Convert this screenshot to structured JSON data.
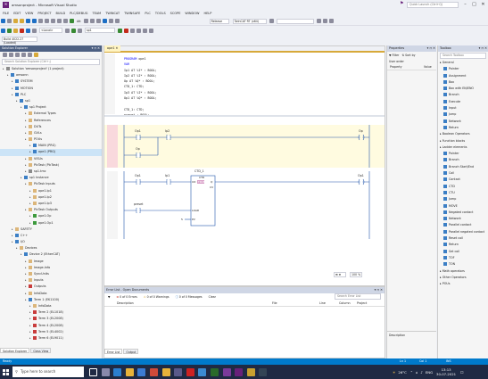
{
  "window": {
    "title": "amsonproject - Microsoft Visual Studio",
    "quick_launch_placeholder": "Quick Launch (Ctrl+Q)"
  },
  "menu": [
    "FILE",
    "EDIT",
    "VIEW",
    "PROJECT",
    "BUILD",
    "PLC/DEBUG",
    "TEAM",
    "TWINCAT",
    "TWINSAFE",
    "PLC",
    "TOOLS",
    "SCOPE",
    "WINDOW",
    "HELP"
  ],
  "toolbar": {
    "config": "Release",
    "platform": "TwinCAT RT (x64)",
    "target": "<Local>",
    "plc_project": "sp1",
    "build_label": "Build 4022.27 (Loaded)",
    "attach": "Att"
  },
  "solution_explorer": {
    "title": "Solution Explorer",
    "search_placeholder": "Search Solution Explorer (Ctrl+;)",
    "items": [
      {
        "label": "Solution 'amsonproject' (1 project)",
        "indent": 0,
        "icon": "gray"
      },
      {
        "label": "amsonn",
        "indent": 1,
        "icon": "blue"
      },
      {
        "label": "SYSTEM",
        "indent": 2,
        "icon": "blue"
      },
      {
        "label": "MOTION",
        "indent": 2,
        "icon": "blue"
      },
      {
        "label": "PLC",
        "indent": 2,
        "icon": "blue"
      },
      {
        "label": "sp1",
        "indent": 3,
        "icon": "blue"
      },
      {
        "label": "sp1 Project",
        "indent": 4,
        "icon": "blue"
      },
      {
        "label": "External Types",
        "indent": 5,
        "icon": "yellow"
      },
      {
        "label": "References",
        "indent": 5,
        "icon": "yellow"
      },
      {
        "label": "DUTs",
        "indent": 5,
        "icon": "yellow"
      },
      {
        "label": "GVLs",
        "indent": 5,
        "icon": "yellow"
      },
      {
        "label": "POUs",
        "indent": 5,
        "icon": "yellow"
      },
      {
        "label": "MAIN (PRG)",
        "indent": 6,
        "icon": "blue"
      },
      {
        "label": "ope1 (PRG)",
        "indent": 6,
        "icon": "blue",
        "selected": true
      },
      {
        "label": "VISUs",
        "indent": 5,
        "icon": "yellow"
      },
      {
        "label": "PlcTask (PlcTask)",
        "indent": 5,
        "icon": "yellow"
      },
      {
        "label": "sp1.tmc",
        "indent": 5,
        "icon": "gray"
      },
      {
        "label": "sp1 Instance",
        "indent": 4,
        "icon": "blue"
      },
      {
        "label": "PlcTask Inputs",
        "indent": 5,
        "icon": "yellow"
      },
      {
        "label": "ope1.Ip1",
        "indent": 6,
        "icon": "yellow"
      },
      {
        "label": "ope1.Ip2",
        "indent": 6,
        "icon": "yellow"
      },
      {
        "label": "ope1.Ip3",
        "indent": 6,
        "icon": "yellow"
      },
      {
        "label": "PlcTask Outputs",
        "indent": 5,
        "icon": "yellow"
      },
      {
        "label": "ope1.Op",
        "indent": 6,
        "icon": "green"
      },
      {
        "label": "ope1.Op1",
        "indent": 6,
        "icon": "green"
      },
      {
        "label": "SAFETY",
        "indent": 2,
        "icon": "yellow"
      },
      {
        "label": "C++",
        "indent": 2,
        "icon": "blue"
      },
      {
        "label": "I/O",
        "indent": 2,
        "icon": "blue"
      },
      {
        "label": "Devices",
        "indent": 3,
        "icon": "yellow"
      },
      {
        "label": "Device 2 (EtherCAT)",
        "indent": 4,
        "icon": "blue"
      },
      {
        "label": "Image",
        "indent": 5,
        "icon": "yellow"
      },
      {
        "label": "Image-Info",
        "indent": 5,
        "icon": "yellow"
      },
      {
        "label": "SyncUnits",
        "indent": 5,
        "icon": "yellow"
      },
      {
        "label": "Inputs",
        "indent": 5,
        "icon": "yellow"
      },
      {
        "label": "Outputs",
        "indent": 5,
        "icon": "red"
      },
      {
        "label": "InfoData",
        "indent": 5,
        "icon": "yellow"
      },
      {
        "label": "Term 1 (EK1100)",
        "indent": 5,
        "icon": "blue"
      },
      {
        "label": "InfoData",
        "indent": 6,
        "icon": "yellow"
      },
      {
        "label": "Term 2 (EL1018)",
        "indent": 6,
        "icon": "red"
      },
      {
        "label": "Term 3 (EL2008)",
        "indent": 6,
        "icon": "red"
      },
      {
        "label": "Term 4 (EL2008)",
        "indent": 6,
        "icon": "red"
      },
      {
        "label": "Term 5 (EL4002)",
        "indent": 6,
        "icon": "red"
      },
      {
        "label": "Term 6 (EL9011)",
        "indent": 6,
        "icon": "red"
      }
    ],
    "tab_active": "Solution Explorer",
    "tab_other": "Class View"
  },
  "editor": {
    "tab": "ope1",
    "code": [
      {
        "kw": "PROGRAM",
        "rest": " ope1"
      },
      {
        "kw": "VAR",
        "rest": ""
      },
      {
        "kw": "",
        "rest": "    Ip1 AT %I* : BOOL;"
      },
      {
        "kw": "",
        "rest": "    Ip2 AT %I* : BOOL;"
      },
      {
        "kw": "",
        "rest": "    Op AT %Q* : BOOL;"
      },
      {
        "kw": "",
        "rest": "    CTD_1: CTD;"
      },
      {
        "kw": "",
        "rest": "    Ip3 AT %I* : BOOL;"
      },
      {
        "kw": "",
        "rest": "    Op1 AT %Q* : BOOL;"
      },
      {
        "kw": "",
        "rest": ""
      },
      {
        "kw": "",
        "rest": "    CTD_1: CTD;"
      },
      {
        "kw": "",
        "rest": "    preset : BOOL;"
      }
    ],
    "network1": {
      "c1": "Op1",
      "c2": "Ip2",
      "c3": "Op",
      "coil": "Op"
    },
    "network2": {
      "c1": "Op1",
      "c2": "Ip1",
      "fb_instance": "CTD_1",
      "fb_type": "CTD",
      "pin_cd": "CD",
      "pin_load": "LOAD",
      "pin_pv": "PV",
      "pin_q": "Q",
      "pin_cv": "CV",
      "cd_value": "TRUE",
      "coil": "Op1",
      "load_var": "preset",
      "pv_value": "5"
    },
    "zoom": "100 %"
  },
  "error_list": {
    "title": "Error List - Open Documents",
    "errors": "0 of 0 Errors",
    "warnings": "0 of 0 Warnings",
    "messages": "0 of 0 Messages",
    "clear": "Clear",
    "search_placeholder": "Search Error List",
    "columns": [
      "Description",
      "File",
      "Line",
      "Column",
      "Project"
    ],
    "tab_active": "Error List",
    "tab_other": "Output"
  },
  "properties": {
    "title": "Properties",
    "filter": "Filter",
    "sort": "Sort by",
    "user_order": "User order",
    "col_property": "Property",
    "col_value": "Value",
    "description": "Description"
  },
  "toolbox": {
    "title": "Toolbox",
    "search_placeholder": "Search Toolbox",
    "groups": [
      {
        "label": "General",
        "header": true
      },
      {
        "label": "Pointer"
      },
      {
        "label": "Assignment"
      },
      {
        "label": "Box"
      },
      {
        "label": "Box with EN/ENO"
      },
      {
        "label": "Branch"
      },
      {
        "label": "Execute"
      },
      {
        "label": "Input"
      },
      {
        "label": "Jump"
      },
      {
        "label": "Network"
      },
      {
        "label": "Return"
      },
      {
        "label": "Boolean Operators",
        "header": true
      },
      {
        "label": "Function blocks",
        "header": true
      },
      {
        "label": "Ladder elements",
        "header": true
      },
      {
        "label": "Pointer"
      },
      {
        "label": "Branch"
      },
      {
        "label": "Branch Start/End"
      },
      {
        "label": "Coil"
      },
      {
        "label": "Contact"
      },
      {
        "label": "CTD"
      },
      {
        "label": "CTU"
      },
      {
        "label": "Jump"
      },
      {
        "label": "MOVE"
      },
      {
        "label": "Negated contact"
      },
      {
        "label": "Network"
      },
      {
        "label": "Parallel contact"
      },
      {
        "label": "Parallel negated contact"
      },
      {
        "label": "Reset coil"
      },
      {
        "label": "Return"
      },
      {
        "label": "Set coil"
      },
      {
        "label": "TOF"
      },
      {
        "label": "TON"
      },
      {
        "label": "Math operators",
        "header": true
      },
      {
        "label": "Other Operators",
        "header": true
      },
      {
        "label": "POUs",
        "header": true
      }
    ]
  },
  "status": {
    "left": "Ready",
    "ln": "Ln 1",
    "col": "Col 1",
    "ins": "INS"
  },
  "taskbar": {
    "search_placeholder": "Type here to search",
    "temp": "26°C",
    "lang": "ENG",
    "time": "13:13",
    "date": "30-07-2021"
  }
}
